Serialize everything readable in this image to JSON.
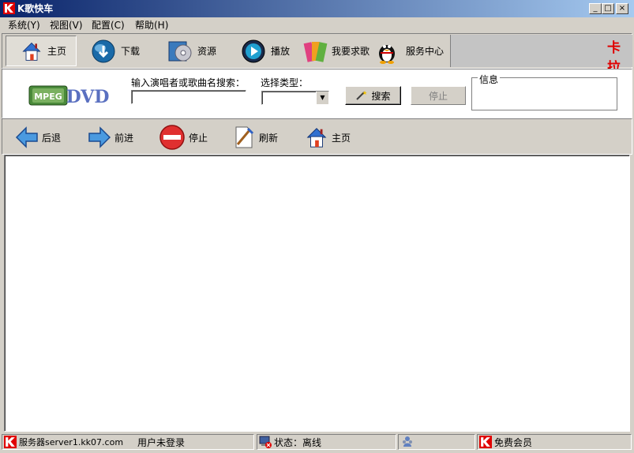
{
  "window": {
    "title": "K歌快车",
    "controls": {
      "minimize": "_",
      "maximize": "□",
      "close": "×"
    }
  },
  "menu": [
    {
      "label": "系统(Y)"
    },
    {
      "label": "视图(V)"
    },
    {
      "label": "配置(C)"
    },
    {
      "label": "帮助(H)"
    }
  ],
  "main_toolbar": {
    "items": [
      {
        "label": "主页",
        "icon": "home-icon",
        "active": true
      },
      {
        "label": "下载",
        "icon": "download-globe-icon"
      },
      {
        "label": "资源",
        "icon": "resource-cd-icon"
      },
      {
        "label": "播放",
        "icon": "play-disc-icon"
      },
      {
        "label": "我要求歌",
        "icon": "request-song-icon"
      },
      {
        "label": "服务中心",
        "icon": "service-penguin-icon"
      }
    ],
    "marquee_text": "卡拉"
  },
  "search": {
    "logo_text_left": "MPEG",
    "logo_text_right": "DVD",
    "query_label": "输入演唱者或歌曲名搜索：",
    "query_value": "",
    "type_label": "选择类型：",
    "type_value": "",
    "search_button": "搜索",
    "stop_button": "停止",
    "info_label": "信息",
    "info_value": ""
  },
  "nav_toolbar": {
    "items": [
      {
        "label": "后退",
        "icon": "back-arrow-icon"
      },
      {
        "label": "前进",
        "icon": "forward-arrow-icon"
      },
      {
        "label": "停止",
        "icon": "stop-icon"
      },
      {
        "label": "刷新",
        "icon": "refresh-icon"
      },
      {
        "label": "主页",
        "icon": "home-icon"
      }
    ]
  },
  "statusbar": {
    "server": "服务器server1.kk07.com",
    "user": "用户未登录",
    "status": "状态：离线",
    "membership": "免费会员"
  },
  "colors": {
    "title_gradient_start": "#0a246a",
    "title_gradient_end": "#a6caf0",
    "brand_red": "#e00000",
    "window_face": "#d4d0c8"
  }
}
